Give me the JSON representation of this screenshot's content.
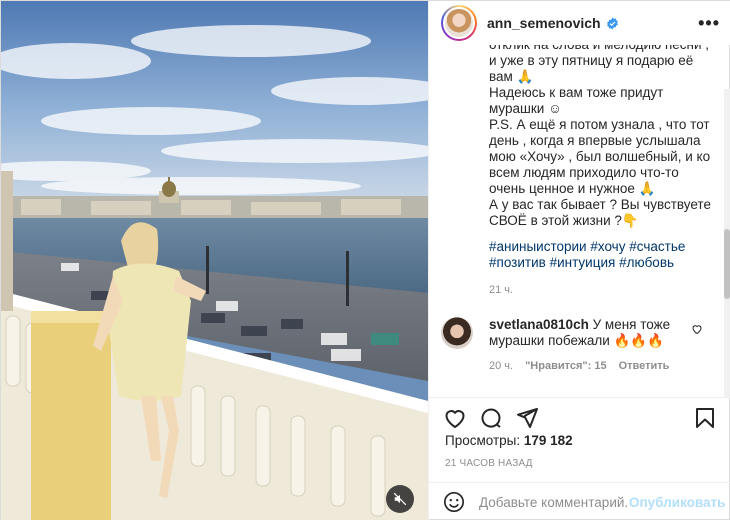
{
  "post": {
    "username": "ann_semenovich",
    "more_icon": "more-horizontal-icon",
    "caption": "отклик на слова и мелодию песни ,\nи уже в эту пятницу я подарю её\nвам 🙏\nНадеюсь к вам тоже придут\nмурашки ☺\nP.S. А ещё я потом узнала , что тот\nдень , когда я впервые услышала\nмою «Хочу» , был волшебный, и ко\nвсем людям приходило что-то\nочень ценное и нужное 🙏\nА у вас так бывает ? Вы чувствуете\nСВОЁ в этой жизни ?👇",
    "hashtags": [
      "#аниныистории",
      "#хочу",
      "#счастье",
      "#позитив",
      "#интуиция",
      "#любовь"
    ],
    "caption_time": "21 ч."
  },
  "comment": {
    "username": "svetlana0810ch",
    "text": "У меня тоже мурашки побежали 🔥🔥🔥",
    "time": "20 ч.",
    "likes": "\"Нравится\": 15",
    "reply": "Ответить"
  },
  "stats": {
    "views_label": "Просмотры:",
    "views_value": "179 182",
    "timestamp": "21 ЧАСОВ НАЗАД"
  },
  "add_comment": {
    "placeholder": "Добавьте комментарий...",
    "post_label": "Опубликовать"
  },
  "colors": {
    "verified": "#3897f0",
    "link": "#00376b",
    "muted": "#8e8e8e",
    "post_disabled": "#b2dffc"
  }
}
